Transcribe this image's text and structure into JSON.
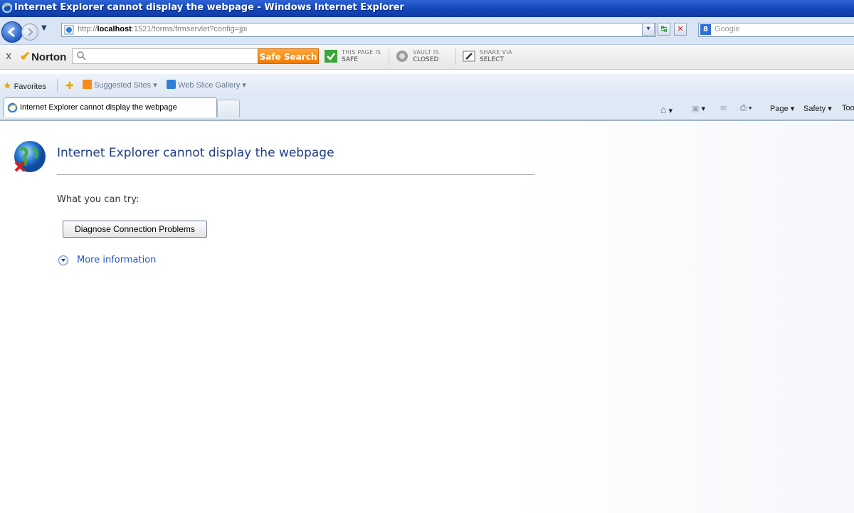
{
  "window": {
    "title": "Internet Explorer cannot display the webpage - Windows Internet Explorer"
  },
  "address_bar": {
    "url_prefix": "http://",
    "url_host": "localhost",
    "url_rest": ":1521/forms/frmservlet?config=jpi"
  },
  "search": {
    "placeholder": "Google",
    "provider_icon": "g-icon"
  },
  "norton": {
    "close": "x",
    "logo": "Norton",
    "search_button": "Safe Search",
    "page_status_line1": "THIS PAGE IS",
    "page_status_line2": "SAFE",
    "vault_line1": "VAULT IS",
    "vault_line2": "CLOSED",
    "share_line1": "SHARE VIA",
    "share_line2": "SELECT"
  },
  "favorites_bar": {
    "favorites": "Favorites",
    "suggested_sites": "Suggested Sites ▾",
    "web_slice_gallery": "Web Slice Gallery ▾"
  },
  "tabs": [
    {
      "label": "Internet Explorer cannot display the webpage"
    }
  ],
  "command_bar": {
    "page": "Page ▾",
    "safety": "Safety ▾",
    "tools": "Too"
  },
  "content": {
    "title": "Internet Explorer cannot display the webpage",
    "what_you_can_try": "What you can try:",
    "diagnose_button": "Diagnose Connection Problems",
    "more_information": "More information"
  },
  "colors": {
    "titlebar": "#1546b8",
    "error_title": "#1f3d87",
    "link": "#1f54c4",
    "safe_search": "#f07c00"
  }
}
